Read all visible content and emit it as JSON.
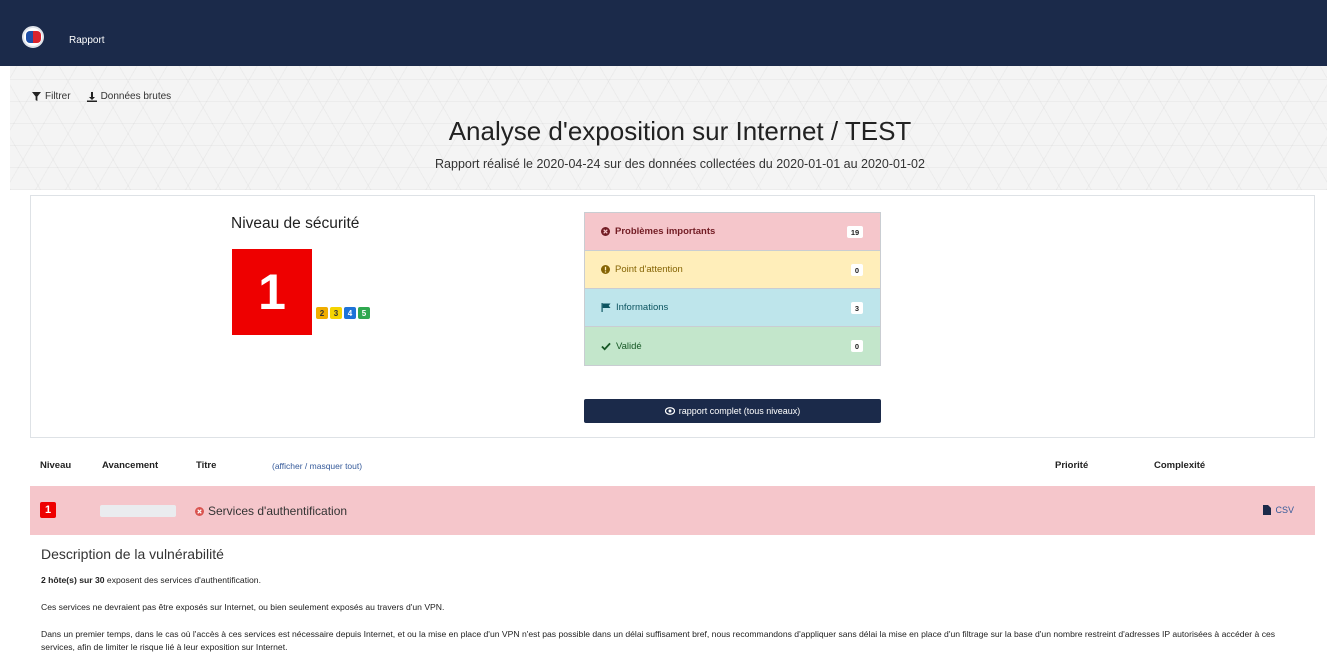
{
  "app": {
    "brand": "Rapport"
  },
  "toolbar": {
    "filter_label": "Filtrer",
    "raw_data_label": "Données brutes"
  },
  "header": {
    "title": "Analyse d'exposition sur Internet / TEST",
    "subtitle": "Rapport réalisé le 2020-04-24 sur des données collectées du 2020-01-01 au 2020-01-02"
  },
  "security": {
    "title": "Niveau de sécurité",
    "level": "1",
    "other_levels": [
      "2",
      "3",
      "4",
      "5"
    ]
  },
  "counts": [
    {
      "label": "Problèmes importants",
      "value": "19",
      "icon": "times-circle-icon"
    },
    {
      "label": "Point d'attention",
      "value": "0",
      "icon": "exclamation-circle-icon"
    },
    {
      "label": "Informations",
      "value": "3",
      "icon": "flag-icon"
    },
    {
      "label": "Validé",
      "value": "0",
      "icon": "check-icon"
    }
  ],
  "full_report_label": "rapport complet (tous niveaux)",
  "table": {
    "headers": {
      "level": "Niveau",
      "progress": "Avancement",
      "title": "Titre",
      "toggle": "(afficher / masquer tout)",
      "priority": "Priorité",
      "complexity": "Complexité"
    }
  },
  "vulnerability": {
    "level": "1",
    "progress": 0.0,
    "title": "Services d'authentification",
    "csv_label": "CSV",
    "description_title": "Description de la vulnérabilité",
    "hosts_bold": "2 hôte(s) sur 30",
    "hosts_rest": " exposent des services d'authentification.",
    "p2": "Ces services ne devraient pas être exposés sur Internet, ou bien seulement exposés au travers d'un VPN.",
    "p3": "Dans un premier temps, dans le cas où l'accès à ces services est nécessaire depuis Internet, et ou la mise en place d'un VPN n'est pas possible dans un délai suffisament bref, nous recommandons d'appliquer sans délai la mise en place d'un filtrage sur la base d'un nombre restreint d'adresses IP autorisées à accéder à ces services, afin de limiter le risque lié à leur exposition sur Internet."
  },
  "colors": {
    "navbar": "#1b2a4a",
    "danger": "#ee0000",
    "danger_bg": "#f5c6cb"
  }
}
